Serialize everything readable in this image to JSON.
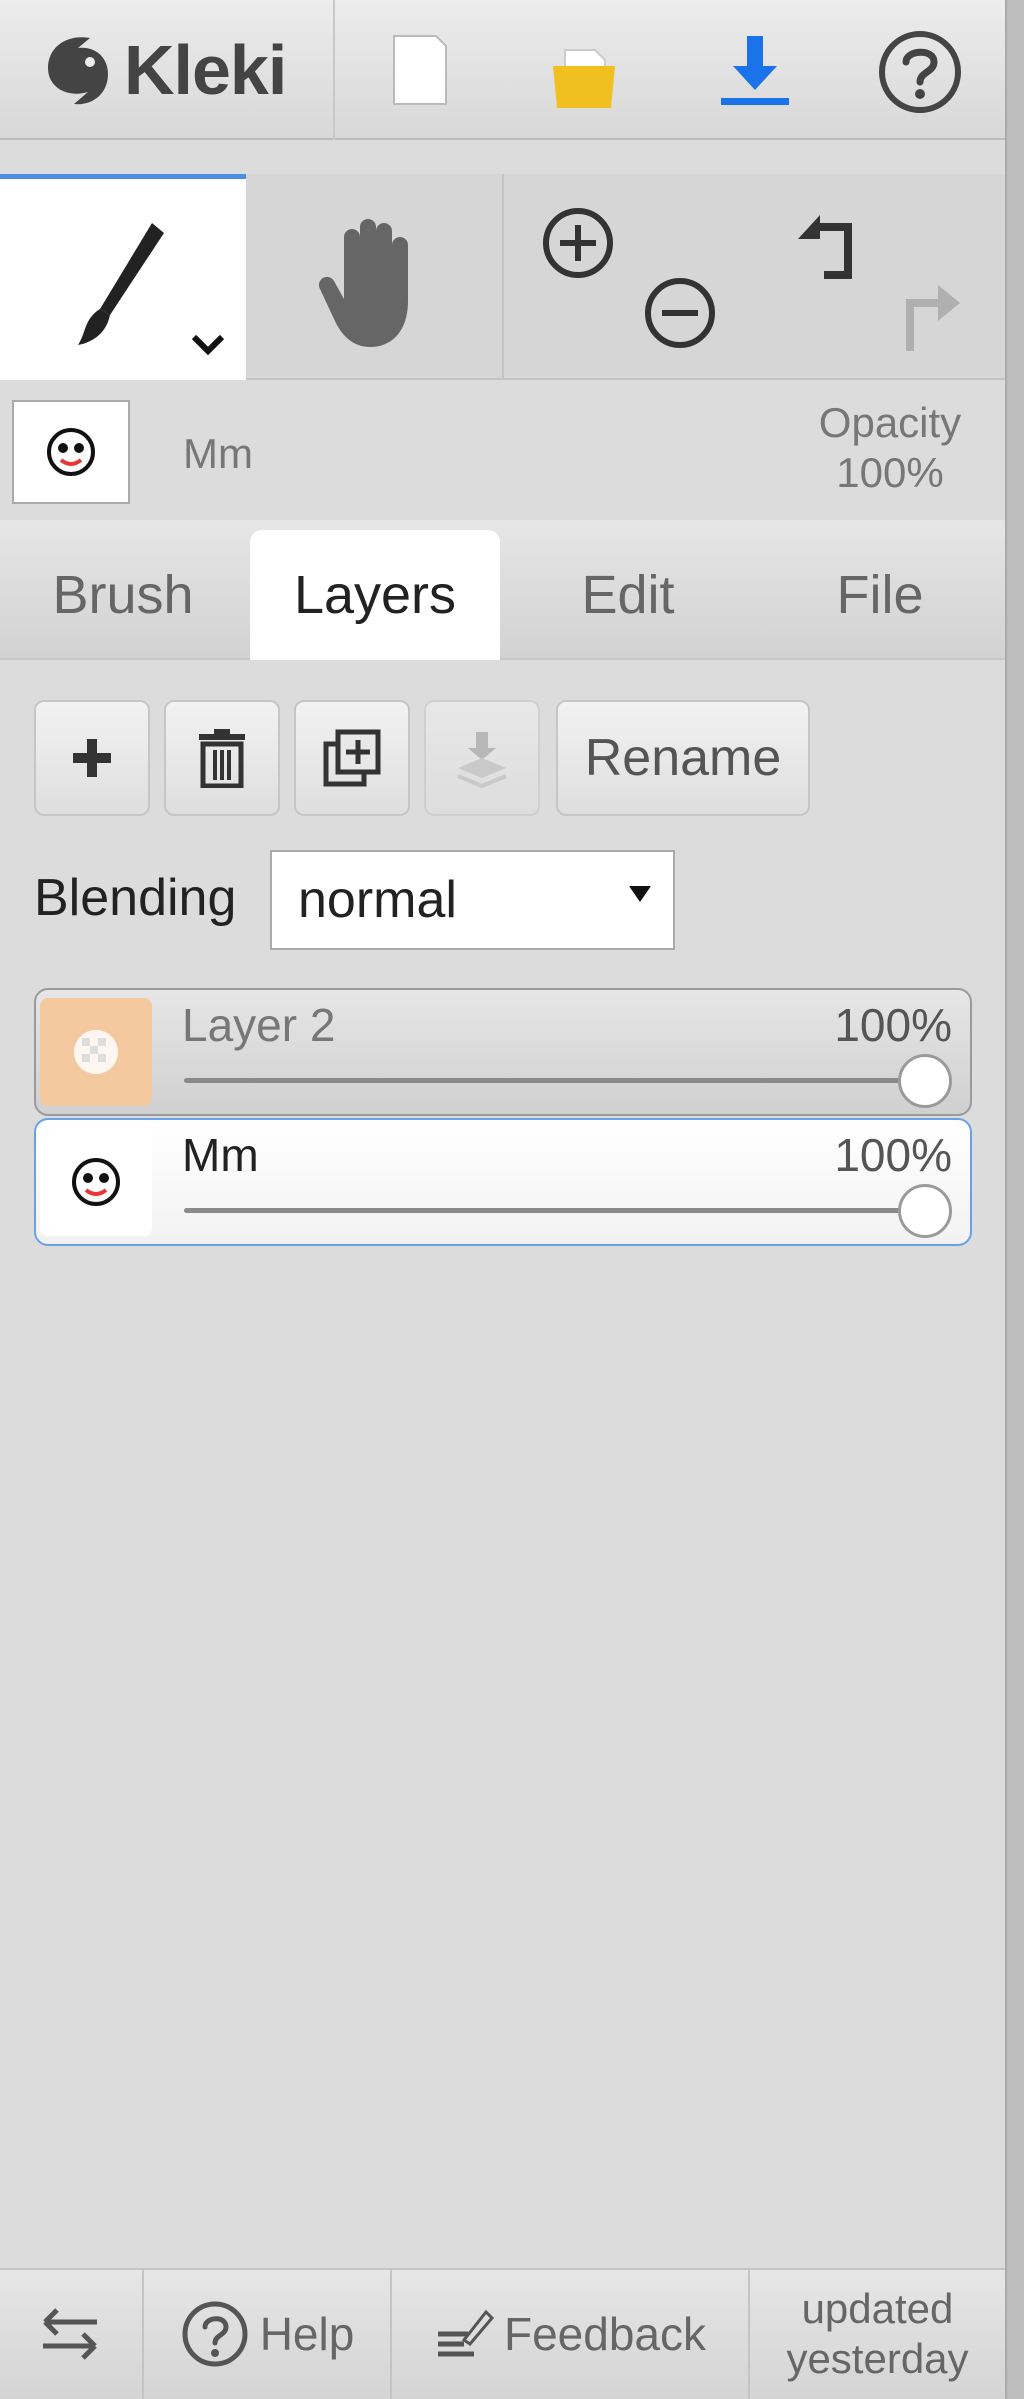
{
  "app": {
    "name": "Kleki"
  },
  "brush_info": {
    "layer_name": "Mm",
    "opacity_label": "Opacity",
    "opacity_value": "100%"
  },
  "tabs": [
    {
      "label": "Brush",
      "active": false
    },
    {
      "label": "Layers",
      "active": true
    },
    {
      "label": "Edit",
      "active": false
    },
    {
      "label": "File",
      "active": false
    }
  ],
  "layer_actions": {
    "rename_label": "Rename"
  },
  "blending": {
    "label": "Blending",
    "value": "normal"
  },
  "layers": [
    {
      "name": "Layer 2",
      "opacity": "100%",
      "opacity_fraction": 1.0,
      "selected": false
    },
    {
      "name": "Mm",
      "opacity": "100%",
      "opacity_fraction": 1.0,
      "selected": true
    }
  ],
  "footer": {
    "help_label": "Help",
    "feedback_label": "Feedback",
    "updated_line1": "updated",
    "updated_line2": "yesterday"
  },
  "colors": {
    "accent": "#1a73e8",
    "folder": "#f0c020",
    "layer2_thumb": "#f5c9a0",
    "panel_bg": "#dcdcdc"
  },
  "icons": [
    "kleki-logo-icon",
    "new-file-icon",
    "open-folder-icon",
    "download-icon",
    "help-icon",
    "brush-icon",
    "chevron-down-icon",
    "hand-icon",
    "zoom-in-icon",
    "zoom-out-icon",
    "undo-icon",
    "redo-icon",
    "add-layer-icon",
    "delete-icon",
    "duplicate-icon",
    "merge-down-icon",
    "swap-icon",
    "feedback-icon"
  ]
}
